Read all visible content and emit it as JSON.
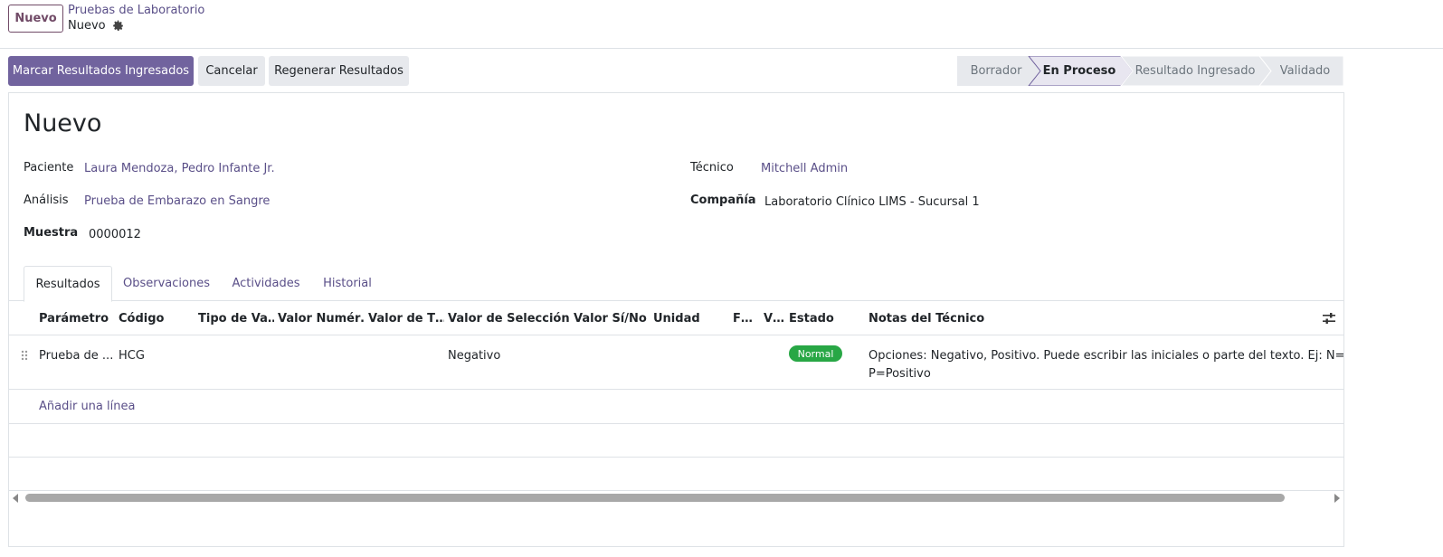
{
  "breadcrumb": {
    "new_button": "Nuevo",
    "parent": "Pruebas de Laboratorio",
    "current": "Nuevo"
  },
  "actions": {
    "mark_results": "Marcar Resultados Ingresados",
    "cancel": "Cancelar",
    "regenerate": "Regenerar Resultados"
  },
  "statusbar": {
    "stages": [
      "Borrador",
      "En Proceso",
      "Resultado Ingresado",
      "Validado"
    ],
    "active": "En Proceso"
  },
  "form": {
    "title": "Nuevo",
    "patient_label": "Paciente",
    "patient_value": "Laura Mendoza, Pedro Infante Jr.",
    "analysis_label": "Análisis",
    "analysis_value": "Prueba de Embarazo en Sangre",
    "sample_label": "Muestra",
    "sample_value": "0000012",
    "technician_label": "Técnico",
    "technician_value": "Mitchell Admin",
    "company_label": "Compañía",
    "company_value": "Laboratorio Clínico LIMS - Sucursal 1"
  },
  "tabs": [
    "Resultados",
    "Observaciones",
    "Actividades",
    "Historial"
  ],
  "table": {
    "headers": [
      "Parámetro",
      "Código",
      "Tipo de Va…",
      "Valor Numér…",
      "Valor de T…",
      "Valor de Selección",
      "Valor Sí/No",
      "Unidad",
      "F…",
      "V…",
      "Estado",
      "Notas del Técnico"
    ],
    "row": {
      "parameter": "Prueba de ...",
      "code": "HCG",
      "selection_value": "Negativo",
      "status": "Normal",
      "notes_line1": "Opciones: Negativo, Positivo. Puede escribir las iniciales o parte del texto. Ej: N=Negativo",
      "notes_line2": "P=Positivo"
    },
    "add_line": "Añadir una línea"
  },
  "colors": {
    "primary": "#71639e",
    "link": "#5a4f88",
    "success": "#28a745",
    "border": "#dee2e6"
  },
  "icons": [
    "gear-icon",
    "drag-handle-icon",
    "column-settings-icon",
    "scroll-left-icon",
    "scroll-right-icon"
  ]
}
